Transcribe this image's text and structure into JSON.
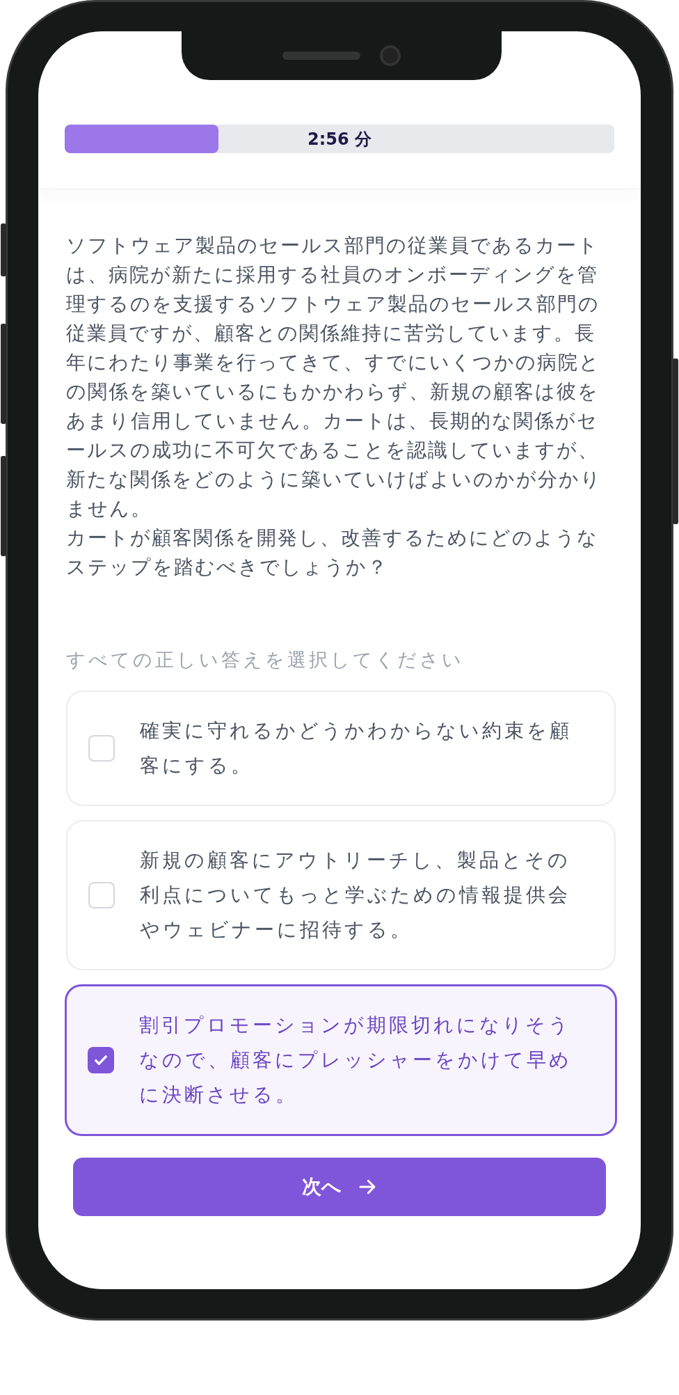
{
  "timer": {
    "level": 0.28,
    "label": "2:56 分"
  },
  "question": [
    "ソフトウェア製品のセールス部門の従業員であるカートは、病院が新たに採用する社員のオンボーディングを管理するのを支援するソフトウェア製品のセールス部門の従業員ですが、顧客との関係維持に苦労しています。長年にわたり事業を行ってきて、すでにいくつかの病院との関係を築いているにもかかわらず、新規の顧客は彼をあまり信用していません。カートは、長期的な関係がセールスの成功に不可欠であることを認識していますが、新たな関係をどのように築いていけばよいのかが分かりません。",
    "カートが顧客関係を開発し、改善するためにどのようなステップを踏むべきでしょうか？"
  ],
  "instruction": "すべての正しい答えを選択してください",
  "options": [
    {
      "text": "確実に守れるかどうかわからない約束を顧客にする。",
      "checked": false
    },
    {
      "text": "新規の顧客にアウトリーチし、製品とその利点についてもっと学ぶための情報提供会やウェビナーに招待する。",
      "checked": false
    },
    {
      "text": "割引プロモーションが期限切れになりそうなので、顧客にプレッシャーをかけて早めに決断させる。",
      "checked": true
    }
  ],
  "next_button": "次へ"
}
